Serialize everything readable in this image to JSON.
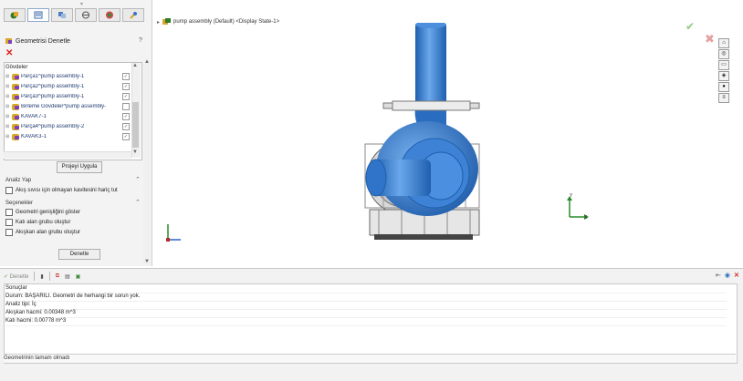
{
  "tabs": [
    "feature-manager-icon",
    "property-manager-icon",
    "configuration-manager-icon",
    "dimxpert-icon",
    "display-manager-icon",
    "pinned-icon"
  ],
  "panel": {
    "title": "Geometrisi Denetle",
    "help": "?",
    "bodies_label": "Gövdeler",
    "bodies": [
      {
        "label": "Parça1^pump assembly-1",
        "checked": true
      },
      {
        "label": "Parça2^pump assembly-1",
        "checked": true
      },
      {
        "label": "Parça3^pump assembly-1",
        "checked": true
      },
      {
        "label": "Birleme Gövdeler^pump assembly-",
        "checked": false
      },
      {
        "label": "KAVAK7-1",
        "checked": true
      },
      {
        "label": "Parça4^pump assembly-2",
        "checked": true
      },
      {
        "label": "KAVAK3-1",
        "checked": true
      }
    ],
    "apply_label": "Projeyi Uygula",
    "analysis_label": "Analiz Yap",
    "analysis_options": [
      "Akış sıvısı için olmayan kavitesini hariç tut"
    ],
    "results_label": "Seçenekler",
    "results_options": [
      "Geometri genişliğini göster",
      "Katı alan grubu oluştur",
      "Akışkan alan grubu oluştur"
    ],
    "check_label": "Denetle"
  },
  "graphics": {
    "tree_label": "pump assembly (Default) <Display State-1>",
    "axis_y": "Y",
    "axis_x": "X"
  },
  "bottom": {
    "toolbar": [
      "Denetle",
      "Kaydet",
      "Göster",
      "Gizle"
    ],
    "results_header": "Sonuçlar",
    "lines": [
      "Durum: BAŞARILI. Geometri de herhangi bir sorun yok.",
      "Analiz tipi: İç",
      "Akışkan hacmi: 0.00348 m^3",
      "Katı hacmi: 0.00778 m^3"
    ],
    "status": "Geometrinin tamam olmadı"
  },
  "colors": {
    "part_blue": "#3f86d9",
    "part_blue_dark": "#1f5fae",
    "gray": "#8a8a8a"
  }
}
